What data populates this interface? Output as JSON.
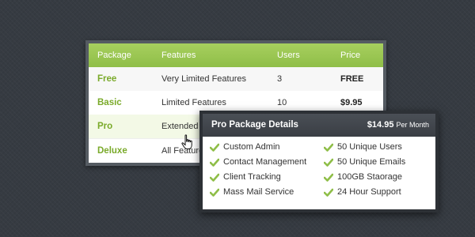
{
  "table": {
    "headers": [
      "Package",
      "Features",
      "Users",
      "Price"
    ],
    "rows": [
      {
        "package": "Free",
        "features": "Very Limited Features",
        "users": "3",
        "price": "FREE"
      },
      {
        "package": "Basic",
        "features": "Limited Features",
        "users": "10",
        "price": "$9.95"
      },
      {
        "package": "Pro",
        "features": "Extended Features",
        "users": "",
        "price": ""
      },
      {
        "package": "Deluxe",
        "features": "All Features",
        "users": "",
        "price": ""
      }
    ]
  },
  "details": {
    "title": "Pro Package Details",
    "price": "$14.95",
    "period": "Per Month",
    "features_left": [
      "Custom Admin",
      "Contact Management",
      "Client Tracking",
      "Mass Mail Service"
    ],
    "features_right": [
      "50 Unique Users",
      "50 Unique Emails",
      "100GB Staorage",
      "24 Hour Support"
    ]
  },
  "colors": {
    "accent_green": "#8fbe48",
    "background": "#363b42"
  },
  "icons": {
    "check": "check-icon",
    "cursor": "hand-cursor-icon"
  }
}
